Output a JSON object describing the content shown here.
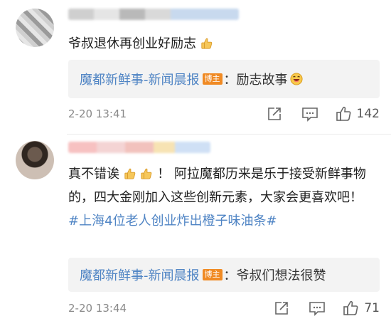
{
  "comments": [
    {
      "text": "爷叔退休再创业好励志",
      "emoji_icon": "thumbs-up-emoji",
      "reply": {
        "author": "魔都新鲜事-新闻晨报",
        "badge": "博主",
        "colon": "：",
        "text": "励志故事",
        "emoji_icon": "laughing-emoji"
      },
      "time": "2-20 13:41",
      "likes": "142"
    },
    {
      "text_prefix": "真不错诶",
      "emoji_icons": [
        "thumbs-up-emoji",
        "thumbs-up-emoji"
      ],
      "text_main": "！ 阿拉魔都历来是乐于接受新鲜事物的，四大金刚加入这些创新元素，大家会更喜欢吧！",
      "hashtag": "#上海4位老人创业炸出橙子味油条#",
      "reply": {
        "author": "魔都新鲜事-新闻晨报",
        "badge": "博主",
        "colon": "：",
        "text": "爷叔们想法很赞"
      },
      "time": "2-20 13:44",
      "likes": "71"
    }
  ],
  "colors": {
    "link": "#4f84c4",
    "badge": "#f08a24",
    "reply_bg": "#f3f3f3",
    "meta_text": "#8a8a8a"
  },
  "icons": [
    "share-icon",
    "comment-icon",
    "like-icon"
  ]
}
